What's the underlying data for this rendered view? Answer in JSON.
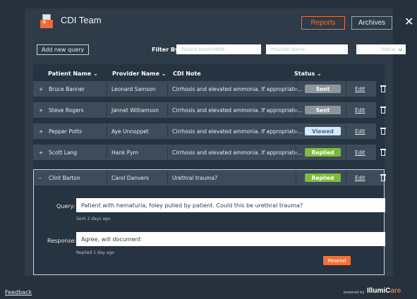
{
  "header": {
    "title": "CDI Team",
    "reports_label": "Reports",
    "archives_label": "Archives",
    "close_label": "✕"
  },
  "filters": {
    "add_query_label": "Add new query",
    "filter_by_label": "Filter By",
    "patient_placeholder": "Patient Name/MRN",
    "provider_placeholder": "Provider Name",
    "status_placeholder": "Status"
  },
  "table": {
    "columns": [
      "Patient Name ⌄",
      "Provider Name ⌄",
      "CDI Note",
      "Status ⌄"
    ],
    "rows": [
      {
        "toggle": "+",
        "patient": "Bruce Banner",
        "provider": "Leonard Samson",
        "note": "Cirrhosis and elevated ammonia. If appropriate...",
        "status": "Sent",
        "edit": "Edit"
      },
      {
        "toggle": "+",
        "patient": "Steve Rogers",
        "provider": "Jannet Williamson",
        "note": "Cirrhosis and elevated ammonia. If appropriate...",
        "status": "Sent",
        "edit": "Edit"
      },
      {
        "toggle": "+",
        "patient": "Pepper Potts",
        "provider": "Aye Unnoppet",
        "note": "Cirrhosis and elevated ammonia. If appropriate...",
        "status": "Viewed",
        "edit": "Edit"
      },
      {
        "toggle": "+",
        "patient": "Scott Lang",
        "provider": "Hank Pym",
        "note": "Cirrhosis and elevated ammonia. If appropriate...",
        "status": "Replied",
        "edit": "Edit"
      }
    ],
    "expanded": {
      "toggle": "–",
      "patient": "Clint Barton",
      "provider": "Carol Danvers",
      "note": "Urethral trauma?",
      "status": "Replied",
      "edit": "Edit",
      "query_label": "Query:",
      "query_text": "Patient with hematuria, foley pulled by patient. Could this be urethral trauma?",
      "query_meta": "Sent 2 days ago",
      "response_label": "Response:",
      "response_text": "Agree, will document",
      "response_meta": "Replied 1 day ago",
      "resend_label": "Resend"
    }
  },
  "footer": {
    "feedback_label": "Feedback",
    "powered_by": "powered by",
    "brand_a": "IllumiC",
    "brand_b": "are"
  },
  "colors": {
    "accent": "#f07238",
    "sent": "#8d969c",
    "viewed": "#d2eafb",
    "replied": "#7dbb3a",
    "background": "#26313d",
    "panel": "#2e3b48"
  }
}
